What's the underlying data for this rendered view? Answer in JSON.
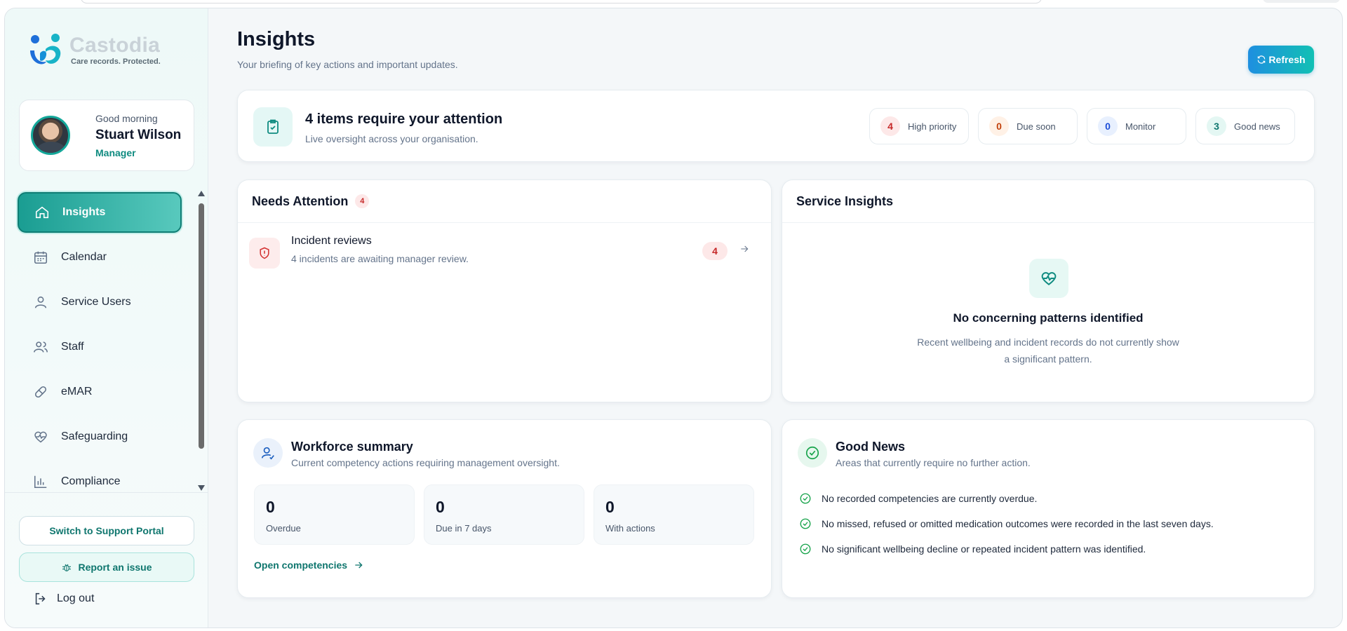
{
  "app": {
    "name": "Castodia",
    "tagline": "Care records. Protected."
  },
  "user": {
    "greeting": "Good morning",
    "name": "Stuart Wilson",
    "role": "Manager"
  },
  "sidebar": {
    "items": [
      {
        "label": "Insights",
        "icon": "home-icon",
        "active": true
      },
      {
        "label": "Calendar",
        "icon": "calendar-icon"
      },
      {
        "label": "Service Users",
        "icon": "user-icon"
      },
      {
        "label": "Staff",
        "icon": "users-icon"
      },
      {
        "label": "eMAR",
        "icon": "pill-icon"
      },
      {
        "label": "Safeguarding",
        "icon": "heart-pulse-icon"
      },
      {
        "label": "Compliance",
        "icon": "bar-chart-icon"
      }
    ],
    "switch_portal": "Switch to Support Portal",
    "report_issue": "Report an issue",
    "logout": "Log out"
  },
  "header": {
    "title": "Insights",
    "subtitle": "Your briefing of key actions and important updates.",
    "refresh_label": "Refresh"
  },
  "attention": {
    "title": "4 items require your attention",
    "subtitle": "Live oversight across your organisation.",
    "pills": [
      {
        "count": "4",
        "label": "High priority",
        "color": "#c62828",
        "bg": "#fde8e8"
      },
      {
        "count": "0",
        "label": "Due soon",
        "color": "#c2410c",
        "bg": "#fff1e6"
      },
      {
        "count": "0",
        "label": "Monitor",
        "color": "#1d4ed8",
        "bg": "#e8f0fe"
      },
      {
        "count": "3",
        "label": "Good news",
        "color": "#0f766e",
        "bg": "#e4f7f3"
      }
    ]
  },
  "needs_attention": {
    "title": "Needs Attention",
    "count": "4",
    "items": [
      {
        "title": "Incident reviews",
        "subtitle": "4 incidents are awaiting manager review.",
        "count": "4"
      }
    ]
  },
  "service_insights": {
    "title": "Service Insights",
    "empty_title": "No concerning patterns identified",
    "empty_text": "Recent wellbeing and incident records do not currently show a significant pattern."
  },
  "workforce": {
    "title": "Workforce summary",
    "subtitle": "Current competency actions requiring management oversight.",
    "stats": [
      {
        "value": "0",
        "label": "Overdue"
      },
      {
        "value": "0",
        "label": "Due in 7 days"
      },
      {
        "value": "0",
        "label": "With actions"
      }
    ],
    "link": "Open competencies"
  },
  "good_news": {
    "title": "Good News",
    "subtitle": "Areas that currently require no further action.",
    "items": [
      "No recorded competencies are currently overdue.",
      "No missed, refused or omitted medication outcomes were recorded in the last seven days.",
      "No significant wellbeing decline or repeated incident pattern was identified."
    ]
  }
}
